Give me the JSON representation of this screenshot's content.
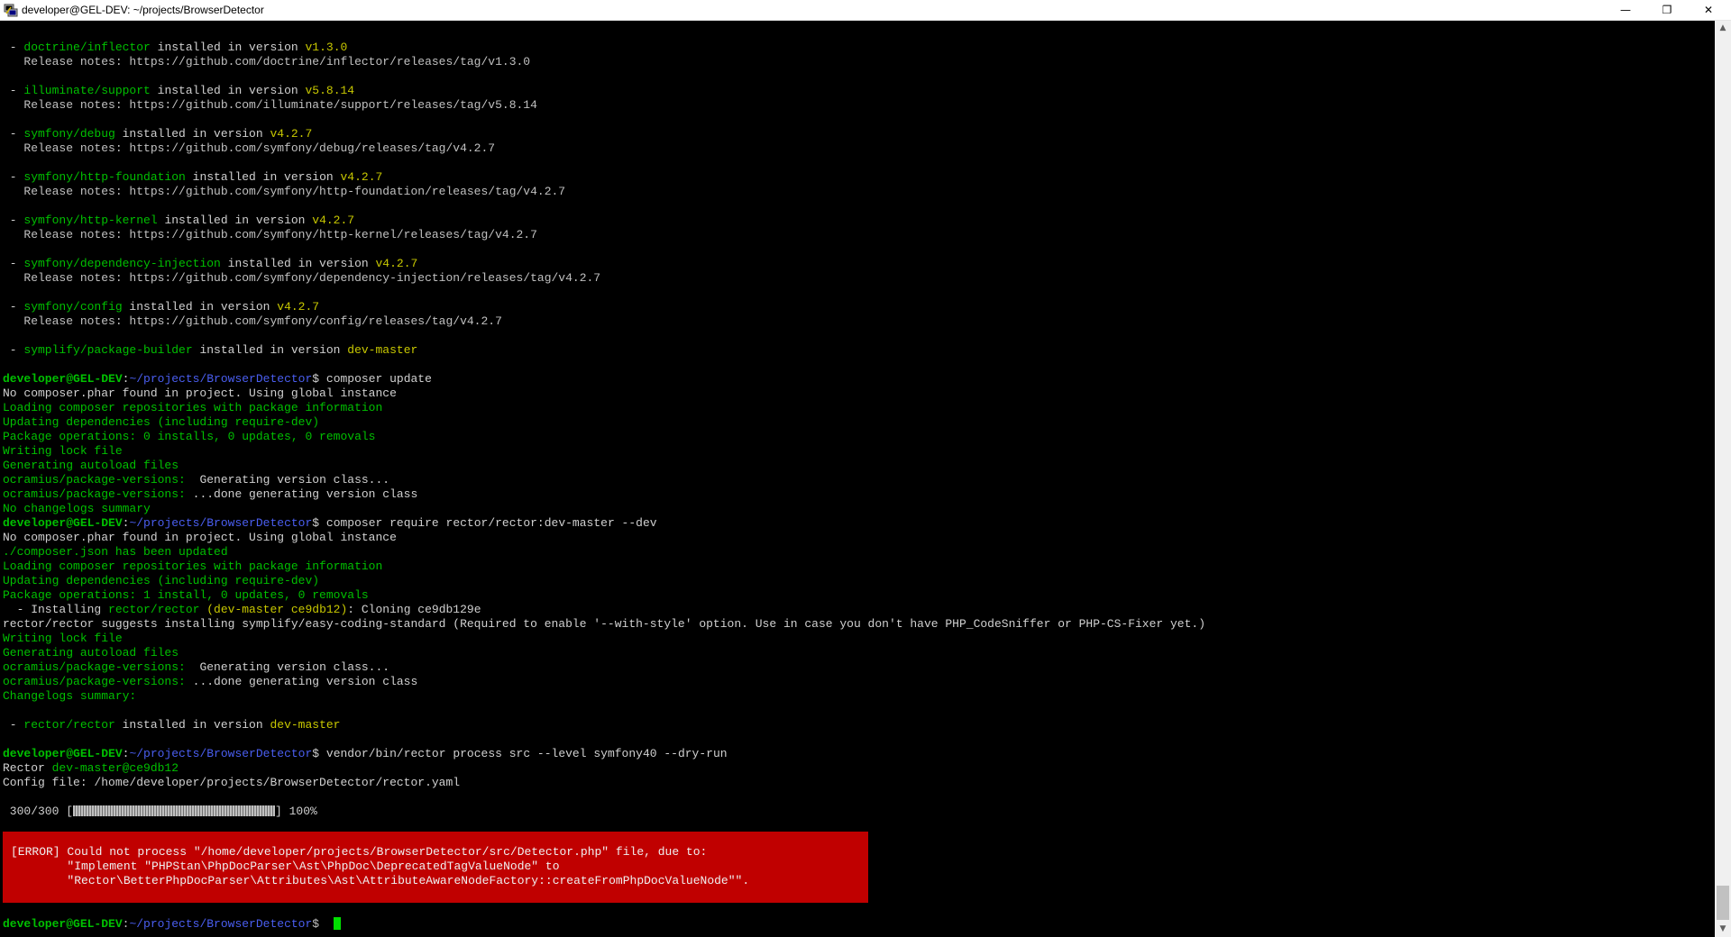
{
  "window": {
    "title": "developer@GEL-DEV: ~/projects/BrowserDetector",
    "minimize_glyph": "—",
    "maximize_glyph": "❐",
    "close_glyph": "✕",
    "icon": "putty-terminal-icon"
  },
  "packages": [
    {
      "dash": " - ",
      "name": "doctrine/inflector",
      "mid": " installed in version ",
      "version": "v1.3.0",
      "notes": "   Release notes: https://github.com/doctrine/inflector/releases/tag/v1.3.0"
    },
    {
      "dash": " - ",
      "name": "illuminate/support",
      "mid": " installed in version ",
      "version": "v5.8.14",
      "notes": "   Release notes: https://github.com/illuminate/support/releases/tag/v5.8.14"
    },
    {
      "dash": " - ",
      "name": "symfony/debug",
      "mid": " installed in version ",
      "version": "v4.2.7",
      "notes": "   Release notes: https://github.com/symfony/debug/releases/tag/v4.2.7"
    },
    {
      "dash": " - ",
      "name": "symfony/http-foundation",
      "mid": " installed in version ",
      "version": "v4.2.7",
      "notes": "   Release notes: https://github.com/symfony/http-foundation/releases/tag/v4.2.7"
    },
    {
      "dash": " - ",
      "name": "symfony/http-kernel",
      "mid": " installed in version ",
      "version": "v4.2.7",
      "notes": "   Release notes: https://github.com/symfony/http-kernel/releases/tag/v4.2.7"
    },
    {
      "dash": " - ",
      "name": "symfony/dependency-injection",
      "mid": " installed in version ",
      "version": "v4.2.7",
      "notes": "   Release notes: https://github.com/symfony/dependency-injection/releases/tag/v4.2.7"
    },
    {
      "dash": " - ",
      "name": "symfony/config",
      "mid": " installed in version ",
      "version": "v4.2.7",
      "notes": "   Release notes: https://github.com/symfony/config/releases/tag/v4.2.7"
    },
    {
      "dash": " - ",
      "name": "symplify/package-builder",
      "mid": " installed in version ",
      "version": "dev-master",
      "notes": ""
    }
  ],
  "prompt": {
    "user": "developer@GEL-DEV",
    "colon": ":",
    "path": "~/projects/BrowserDetector",
    "dollar": "$ "
  },
  "cmd1": {
    "command": "composer update",
    "out1": "No composer.phar found in project. Using global instance",
    "out2": "Loading composer repositories with package information",
    "out3": "Updating dependencies (including require-dev)",
    "out4": "Package operations: 0 installs, 0 updates, 0 removals",
    "out5": "Writing lock file",
    "out6": "Generating autoload files",
    "out7_label": "ocramius/package-versions:",
    "out7_text": "  Generating version class...",
    "out8_label": "ocramius/package-versions:",
    "out8_text": " ...done generating version class",
    "out9": "No changelogs summary"
  },
  "cmd2": {
    "command": "composer require rector/rector:dev-master --dev",
    "out1": "No composer.phar found in project. Using global instance",
    "out2": "./composer.json has been updated",
    "out3": "Loading composer repositories with package information",
    "out4": "Updating dependencies (including require-dev)",
    "out5": "Package operations: 1 install, 0 updates, 0 removals",
    "out6_prefix": "  - Installing ",
    "out6_pkg": "rector/rector",
    "out6_ver": " (dev-master ce9db12)",
    "out6_suffix": ": Cloning ce9db129e",
    "out7": "rector/rector suggests installing symplify/easy-coding-standard (Required to enable '--with-style' option. Use in case you don't have PHP_CodeSniffer or PHP-CS-Fixer yet.)",
    "out8": "Writing lock file",
    "out9": "Generating autoload files",
    "out10_label": "ocramius/package-versions:",
    "out10_text": "  Generating version class...",
    "out11_label": "ocramius/package-versions:",
    "out11_text": " ...done generating version class",
    "out12": "Changelogs summary:",
    "pkg_dash": " - ",
    "pkg_name": "rector/rector",
    "pkg_mid": " installed in version ",
    "pkg_version": "dev-master"
  },
  "cmd3": {
    "command": "vendor/bin/rector process src --level symfony40 --dry-run",
    "rector_label": "Rector ",
    "rector_version": "dev-master@ce9db12",
    "config": "Config file: /home/developer/projects/BrowserDetector/rector.yaml",
    "progress_count": " 300/300 [",
    "progress_end": "] 100%",
    "progress_percent": 100
  },
  "error": {
    "line1": "[ERROR] Could not process \"/home/developer/projects/BrowserDetector/src/Detector.php\" file, due to:",
    "line2": "        \"Implement \"PHPStan\\PhpDocParser\\Ast\\PhpDoc\\DeprecatedTagValueNode\" to",
    "line3": "        \"Rector\\BetterPhpDocParser\\Attributes\\Ast\\AttributeAwareNodeFactory::createFromPhpDocValueNode\"\".",
    "color": "#c00000"
  },
  "colors": {
    "green": "#00c000",
    "yellow": "#c8c800",
    "blue": "#4a5ef0",
    "cursor": "#00e000"
  },
  "scrollbar": {
    "up_glyph": "▲",
    "down_glyph": "▼"
  }
}
